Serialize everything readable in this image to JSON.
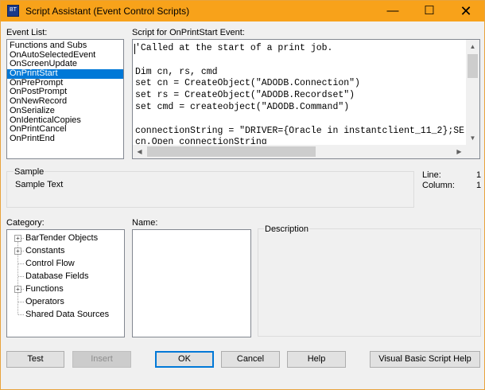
{
  "window": {
    "title": "Script Assistant (Event Control Scripts)",
    "icon_text": "BT"
  },
  "titlebar": {
    "minimize_glyph": "—",
    "maximize_glyph": "☐",
    "close_glyph": "✕"
  },
  "event_list": {
    "label": "Event List:",
    "items": [
      "Functions and Subs",
      "OnAutoSelectedEvent",
      "OnScreenUpdate",
      "OnPrintStart",
      "OnPrePrompt",
      "OnPostPrompt",
      "OnNewRecord",
      "OnSerialize",
      "OnIdenticalCopies",
      "OnPrintCancel",
      "OnPrintEnd"
    ],
    "selected": "OnPrintStart"
  },
  "script": {
    "label": "Script for OnPrintStart Event:",
    "lines": [
      "'Called at the start of a print job.",
      "",
      "Dim cn, rs, cmd",
      "set cn = CreateObject(\"ADODB.Connection\")",
      "set rs = CreateObject(\"ADODB.Recordset\")",
      "set cmd = createobject(\"ADODB.Command\")",
      "",
      "connectionString = \"DRIVER={Oracle in instantclient_11_2};SE",
      "cn.Open connectionString"
    ]
  },
  "sample": {
    "label": "Sample",
    "text": "Sample Text"
  },
  "position": {
    "line_label": "Line:",
    "line_value": "1",
    "column_label": "Column:",
    "column_value": "1"
  },
  "category": {
    "label": "Category:",
    "items": [
      {
        "label": "BarTender Objects",
        "expandable": true
      },
      {
        "label": "Constants",
        "expandable": true
      },
      {
        "label": "Control Flow",
        "expandable": false
      },
      {
        "label": "Database Fields",
        "expandable": false
      },
      {
        "label": "Functions",
        "expandable": true
      },
      {
        "label": "Operators",
        "expandable": false
      },
      {
        "label": "Shared Data Sources",
        "expandable": false
      }
    ],
    "expand_glyph": "+"
  },
  "name_section": {
    "label": "Name:"
  },
  "description": {
    "label": "Description"
  },
  "buttons": {
    "test": "Test",
    "insert": "Insert",
    "ok": "OK",
    "cancel": "Cancel",
    "help": "Help",
    "vbs_help": "Visual Basic Script Help"
  },
  "scroll_glyphs": {
    "up": "▲",
    "down": "▼",
    "left": "◀",
    "right": "▶"
  }
}
